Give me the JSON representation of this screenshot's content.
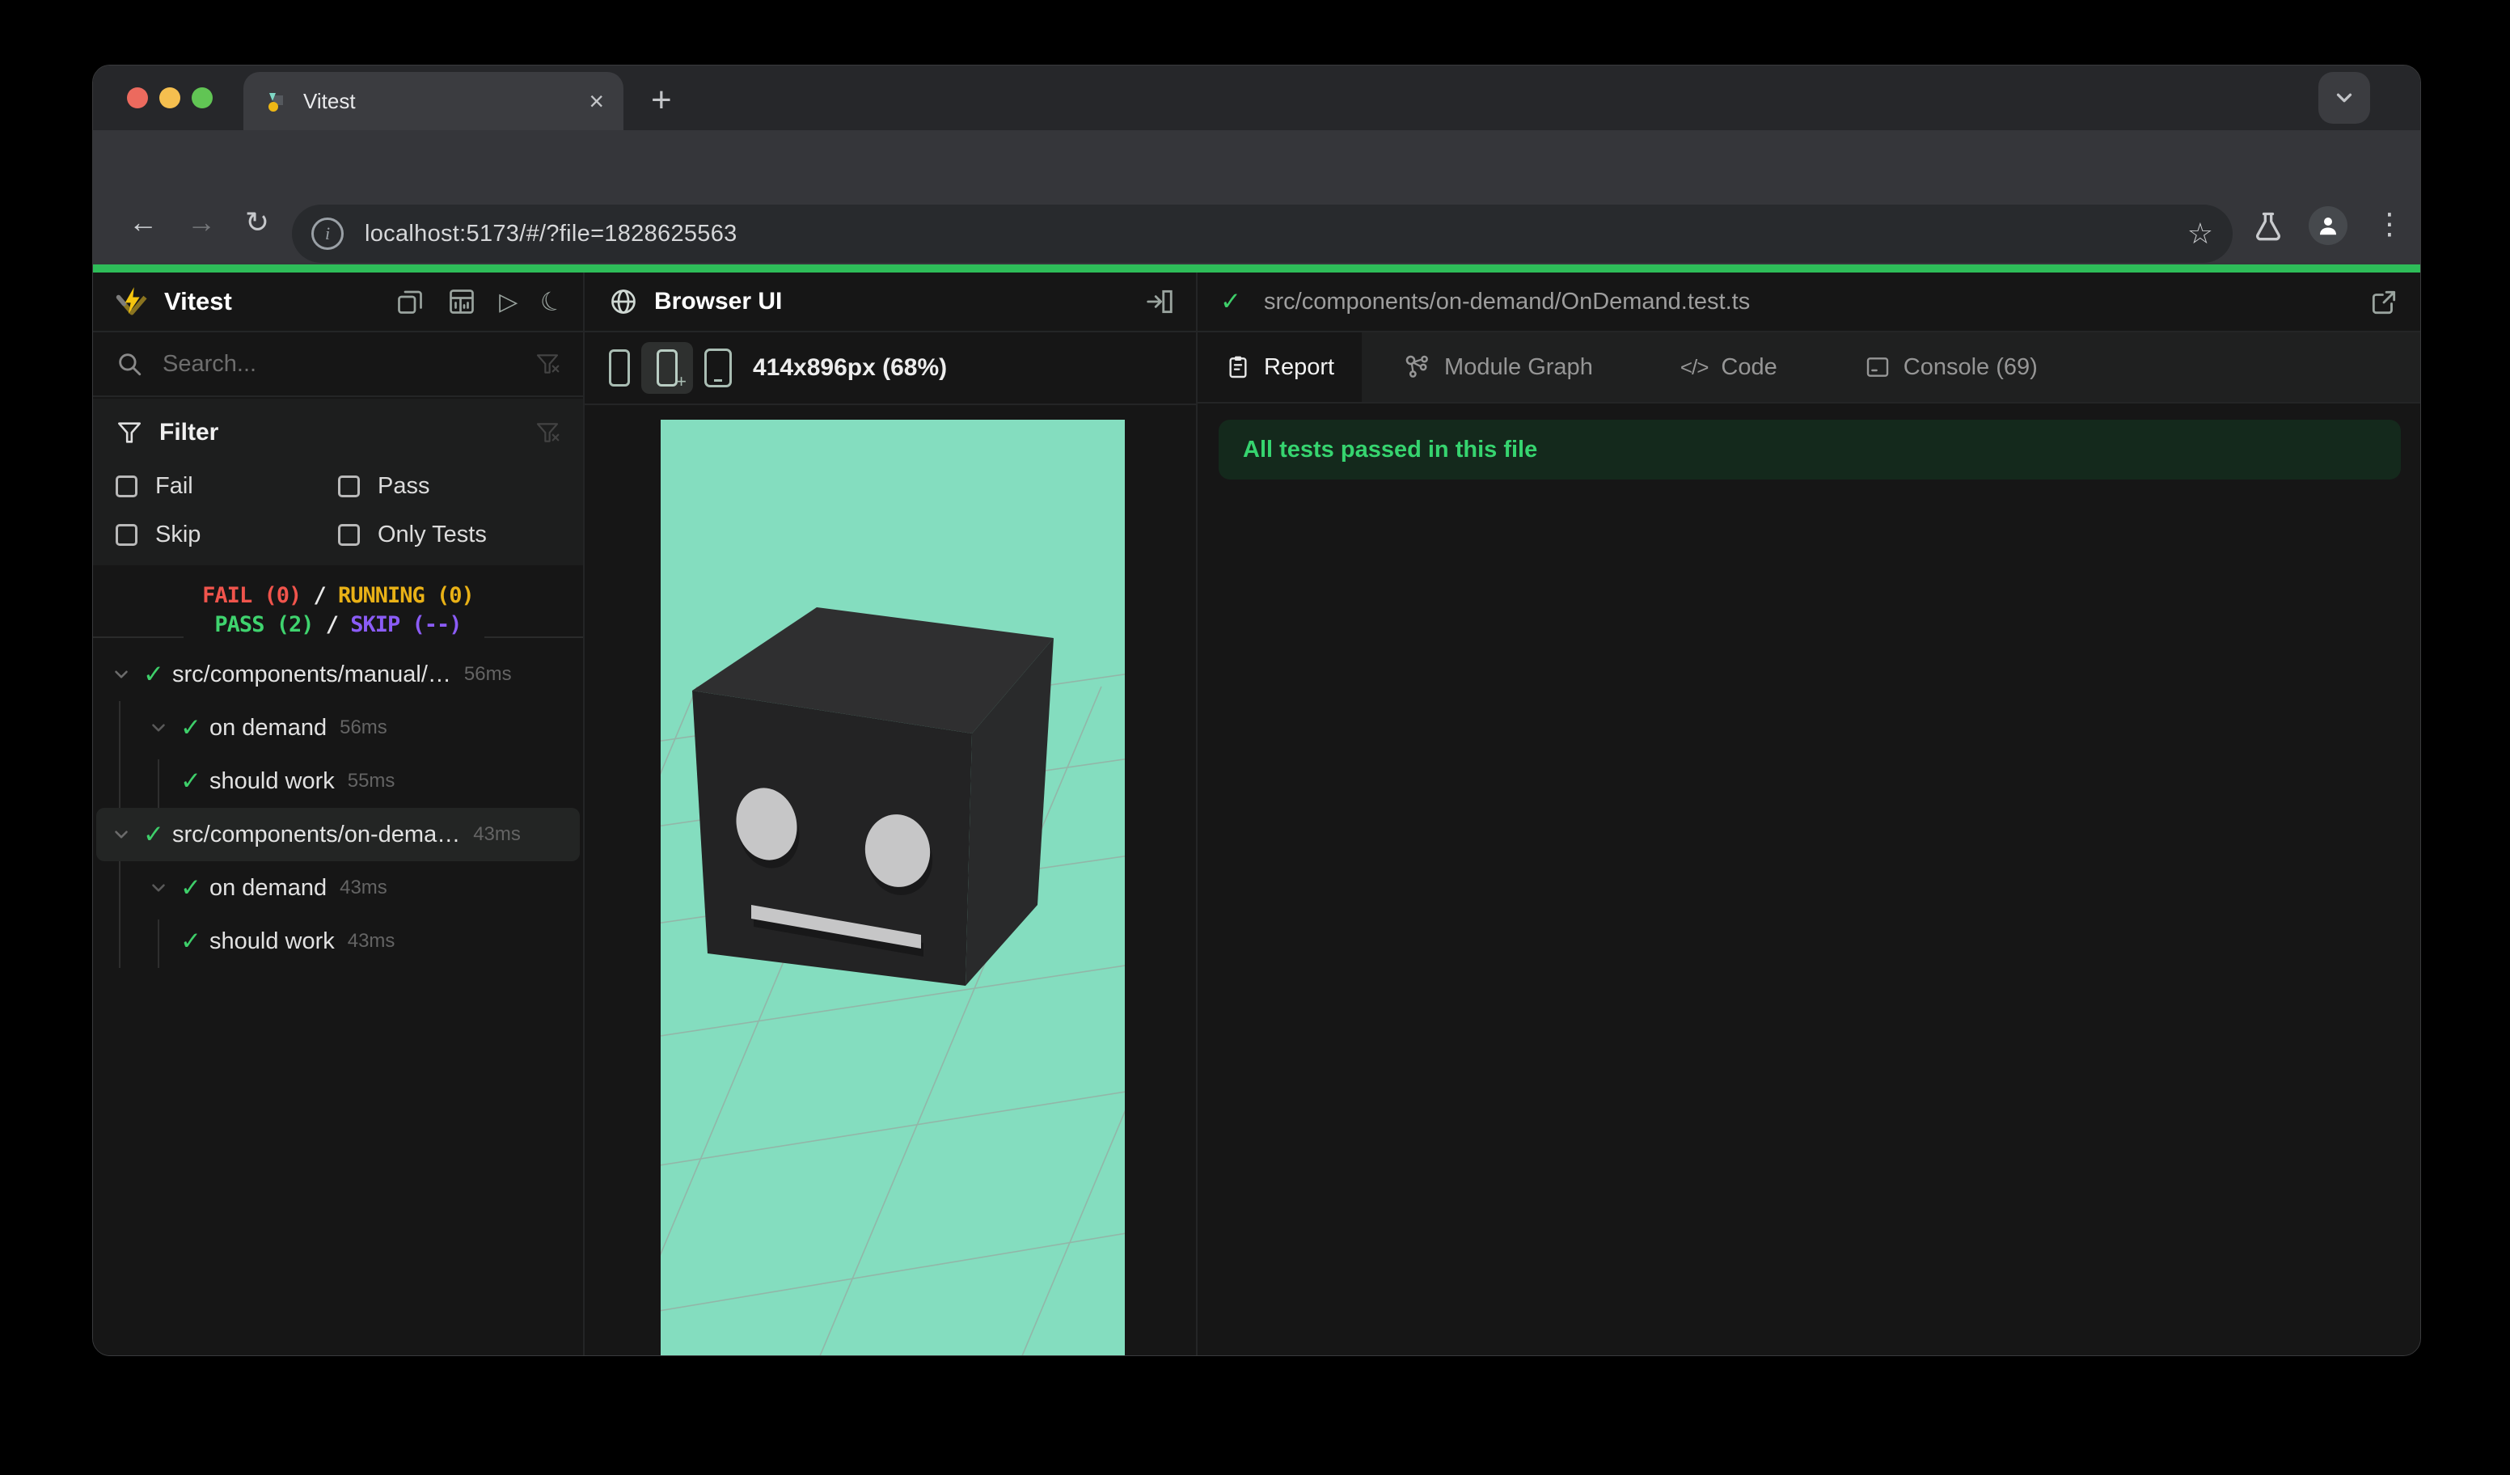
{
  "browser": {
    "tab_title": "Vitest",
    "close_label": "×",
    "new_tab_label": "+",
    "url": "localhost:5173/#/?file=1828625563",
    "back_glyph": "←",
    "forward_glyph": "→",
    "reload_glyph": "↻",
    "star_glyph": "☆",
    "kebab_glyph": "⋮",
    "info_glyph": "i"
  },
  "sidebar": {
    "title": "Vitest",
    "search_placeholder": "Search...",
    "filter": {
      "title": "Filter",
      "fail": "Fail",
      "pass": "Pass",
      "skip": "Skip",
      "only": "Only Tests"
    },
    "status": {
      "fail": "FAIL (0)",
      "running": "RUNNING (0)",
      "pass": "PASS (2)",
      "skip": "SKIP (--)",
      "sep": "/"
    },
    "tree": {
      "check_glyph": "✓",
      "rows": [
        {
          "label": "src/components/manual/…",
          "duration": "56ms"
        },
        {
          "label": "on demand",
          "duration": "56ms"
        },
        {
          "label": "should work",
          "duration": "55ms"
        },
        {
          "label": "src/components/on-dema…",
          "duration": "43ms"
        },
        {
          "label": "on demand",
          "duration": "43ms"
        },
        {
          "label": "should work",
          "duration": "43ms"
        }
      ]
    }
  },
  "preview": {
    "title": "Browser UI",
    "size_label": "414x896px (68%)"
  },
  "results": {
    "file_path": "src/components/on-demand/OnDemand.test.ts",
    "check_glyph": "✓",
    "tabs": [
      "Report",
      "Module Graph",
      "Code",
      "Console (69)"
    ],
    "code_icon_glyph": "</>",
    "banner": "All tests passed in this file"
  },
  "colors": {
    "pass_green": "#3ecf6a",
    "fail_red": "#f0544c",
    "running_amber": "#e9b116",
    "skip_purple": "#8b5cf6",
    "progress_green": "#2ebd59",
    "viewport_mint": "#84ddbf",
    "banner_bg": "#14291c",
    "banner_text": "#36d46f",
    "traffic_red": "#ec6a5e",
    "traffic_yellow": "#f5bf4f",
    "traffic_green": "#61c554"
  }
}
